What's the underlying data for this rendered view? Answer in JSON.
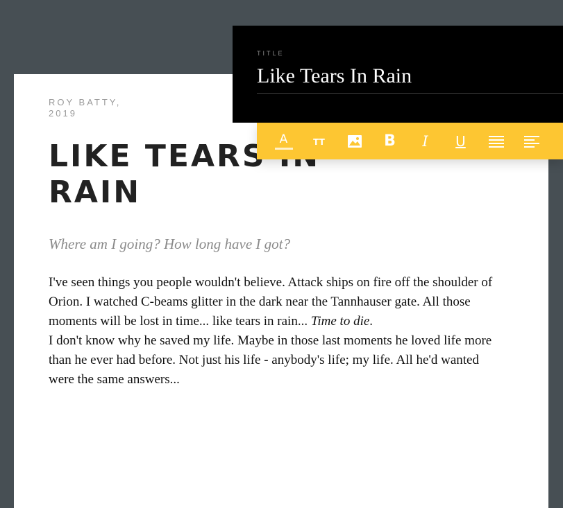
{
  "article": {
    "author_line1": "ROY BATTY,",
    "author_line2": "2019",
    "heading": "LIKE TEARS IN RAIN",
    "subtitle": "Where am I going? How long have I got?",
    "paragraph1_plain": "I've seen things you people wouldn't believe. Attack ships on fire off the shoulder of Orion. I watched C-beams glitter in the dark near the Tannhauser gate. All those moments will be lost in time... like tears in rain... ",
    "paragraph1_italic": "Time to die",
    "paragraph1_end": ".",
    "paragraph2": "I don't know why he saved my life. Maybe in those last moments he loved life more than he ever had before. Not just his life - anybody's life; my life. All he'd wanted were the same answers..."
  },
  "title_panel": {
    "label": "TITLE",
    "value": "Like Tears In Rain"
  },
  "toolbar": {
    "tools": [
      {
        "icon": "text-color-icon",
        "glyph": "A"
      },
      {
        "icon": "text-size-icon",
        "glyph": "TT"
      },
      {
        "icon": "image-icon"
      },
      {
        "icon": "bold-icon",
        "glyph": "B"
      },
      {
        "icon": "italic-icon",
        "glyph": "I"
      },
      {
        "icon": "underline-icon",
        "glyph": "U"
      },
      {
        "icon": "justify-icon"
      },
      {
        "icon": "align-left-icon"
      }
    ]
  },
  "colors": {
    "background": "#474f54",
    "toolbar": "#fdc632",
    "title_panel": "#000000",
    "card": "#ffffff"
  }
}
